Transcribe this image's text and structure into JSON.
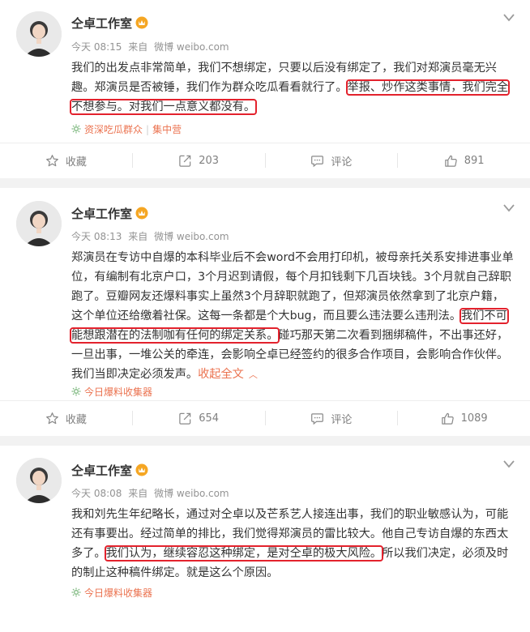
{
  "colors": {
    "accent": "#eb7350",
    "highlight_box": "#e3222d",
    "background": "#f2f2f2"
  },
  "posts": [
    {
      "author": "仝卓工作室",
      "time": "今天 08:15",
      "via": "来自",
      "client": "微博 weibo.com",
      "segments": [
        {
          "text": "我们的出发点非常简单，我们不想绑定，只要以后没有绑定了，我们对郑演员毫无兴趣。郑演员是否被锤，我们作为群众吃瓜看看就行了。",
          "highlight": false
        },
        {
          "text": "举报、炒作这类事情，我们完全不想参与。对我们一点意义都没有。",
          "highlight": true
        }
      ],
      "source_tags": [
        "资深吃瓜群众",
        "集中营"
      ],
      "actions": {
        "favorite": "收藏",
        "repost": "203",
        "comment": "评论",
        "like": "891"
      }
    },
    {
      "author": "仝卓工作室",
      "time": "今天 08:13",
      "via": "来自",
      "client": "微博 weibo.com",
      "segments": [
        {
          "text": "郑演员在专访中自爆的本科毕业后不会word不会用打印机，被母亲托关系安排进事业单位，有编制有北京户口，3个月迟到请假，每个月扣钱剩下几百块钱。3个月就自己辞职跑了。豆瓣网友还爆料事实上虽然3个月辞职就跑了，但郑演员依然拿到了北京户籍，这个单位还给缴着社保。这每一条都是个大bug，而且要么违法要么违刑法。",
          "highlight": false
        },
        {
          "text": "我们不可能想跟潜在的法制咖有任何的绑定关系。",
          "highlight": true
        },
        {
          "text": "碰巧那天第二次看到捆绑稿件，不出事还好，一旦出事，一堆公关的牵连，会影响仝卓已经签约的很多合作项目，会影响合作伙伴。我们当即决定必须发声。",
          "highlight": false
        }
      ],
      "fold_text": "收起全文",
      "source_tags": [
        "今日爆料收集器"
      ],
      "actions": {
        "favorite": "收藏",
        "repost": "654",
        "comment": "评论",
        "like": "1089"
      }
    },
    {
      "author": "仝卓工作室",
      "time": "今天 08:08",
      "via": "来自",
      "client": "微博 weibo.com",
      "segments": [
        {
          "text": "我和刘先生年纪略长，通过对仝卓以及芒系艺人接连出事，我们的职业敏感认为，可能还有事要出。经过简单的排比，我们觉得郑演员的雷比较大。他自己专访自爆的东西太多了。",
          "highlight": false
        },
        {
          "text": "我们认为，继续容忍这种绑定，是对仝卓的极大风险。",
          "highlight": true
        },
        {
          "text": "所以我们决定，必须及时的制止这种稿件绑定。就是这么个原因。",
          "highlight": false
        }
      ],
      "source_tags": [
        "今日爆料收集器"
      ]
    }
  ]
}
